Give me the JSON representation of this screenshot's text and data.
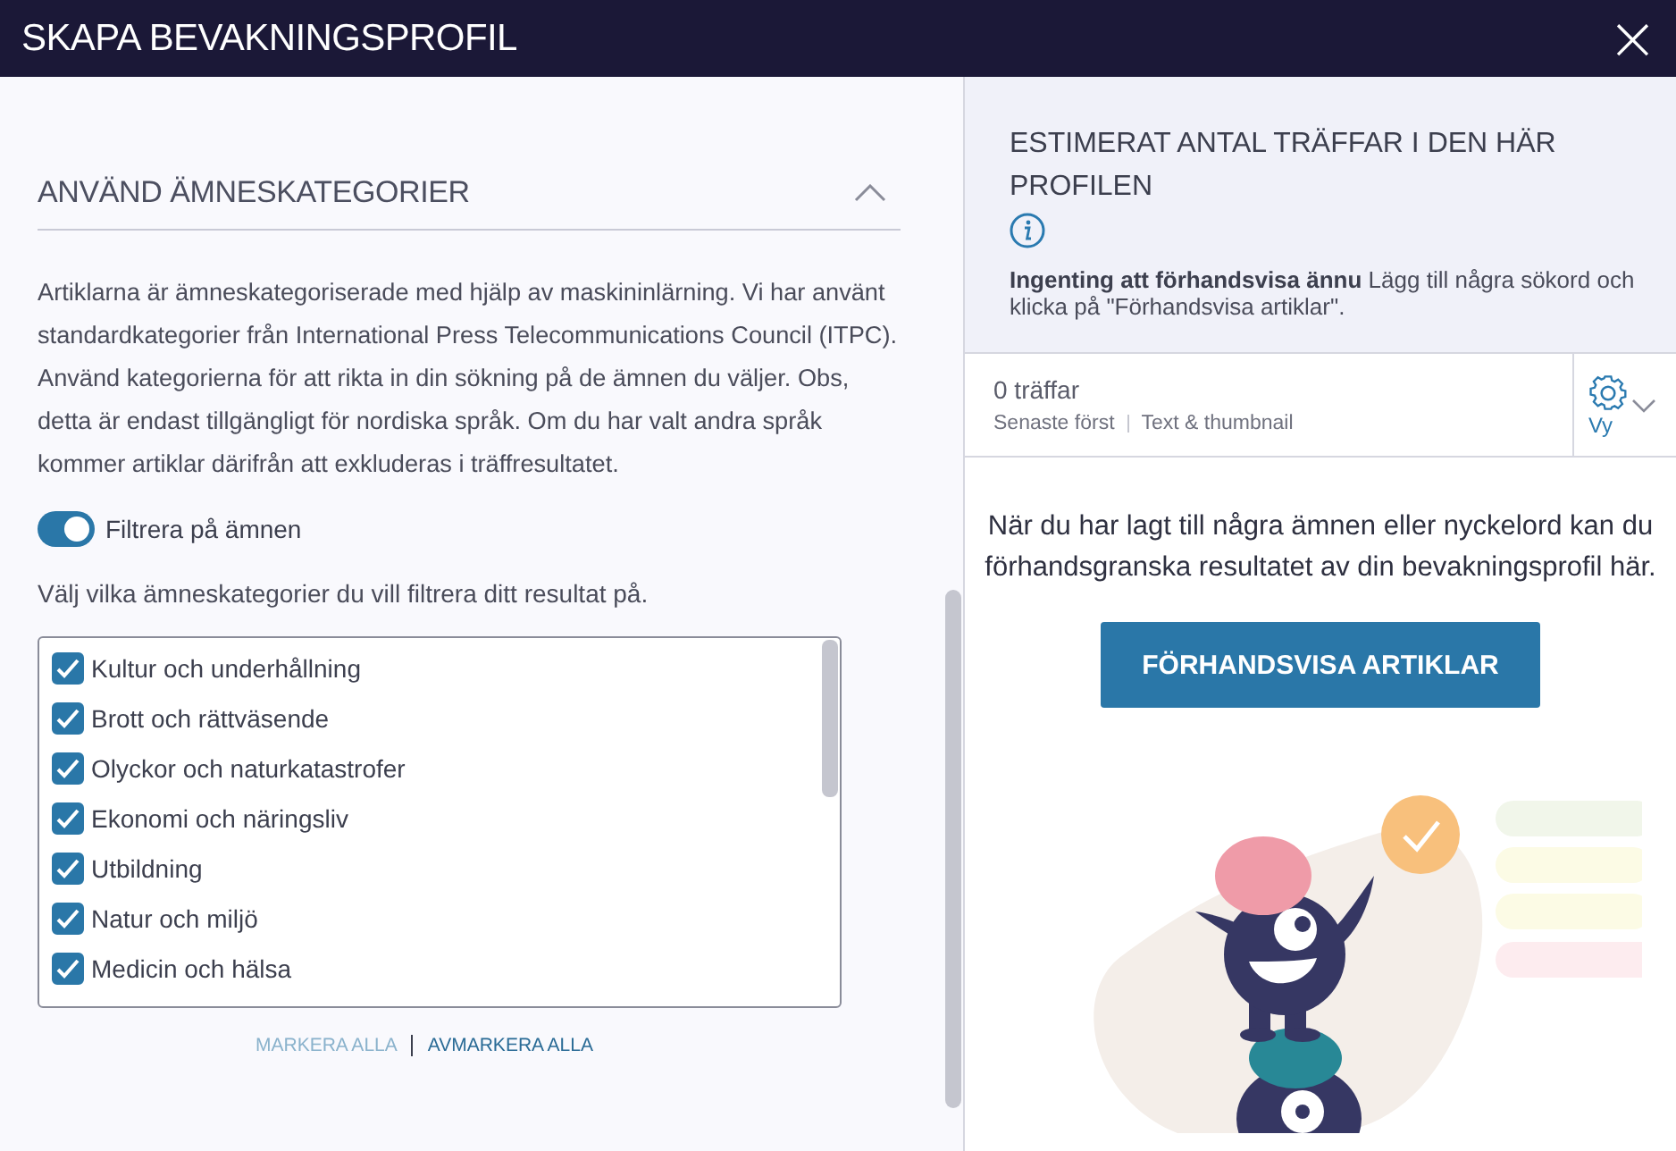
{
  "window": {
    "title": "SKAPA BEVAKNINGSPROFIL",
    "close": "×"
  },
  "section": {
    "title": "ANVÄND ÄMNESKATEGORIER",
    "expanded": true,
    "description": "Artiklarna är ämneskategoriserade med hjälp av maskininlärning. Vi har använt standardkategorier från International Press Telecommunications Council (ITPC). Använd kategorierna för att rikta in din sökning på de ämnen du väljer. Obs, detta är endast tillgängligt för nordiska språk. Om du har valt andra språk kommer artiklar därifrån att exkluderas i träffresultatet.",
    "filter_toggle": {
      "label": "Filtrera på ämnen",
      "on": true
    },
    "prompt": "Välj vilka ämneskategorier du vill filtrera ditt resultat på.",
    "categories": [
      {
        "label": "Kultur och underhållning",
        "checked": true
      },
      {
        "label": "Brott och rättväsende",
        "checked": true
      },
      {
        "label": "Olyckor och naturkatastrofer",
        "checked": true
      },
      {
        "label": "Ekonomi och näringsliv",
        "checked": true
      },
      {
        "label": "Utbildning",
        "checked": true
      },
      {
        "label": "Natur och miljö",
        "checked": true
      },
      {
        "label": "Medicin och hälsa",
        "checked": true
      }
    ],
    "links": [
      {
        "label": "MARKERA ALLA",
        "disabled": true
      },
      {
        "label": "AVMARKERA ALLA",
        "disabled": false
      }
    ]
  },
  "preview": {
    "title": "ESTIMERAT ANTAL TRÄFFAR I DEN HÄR PROFILEN",
    "note": "**Ingenting att förhandsvisa ännu** Lägg till några sökord och klicka på \"Förhandsvisa artiklar\".",
    "hits": "0 träffar",
    "sort": "Senaste först",
    "view_mode": "Text & thumbnail",
    "view_button": "Vy",
    "empty_message": "När du har lagt till några ämnen eller nyckelord kan du förhandsgranska resultatet av din bevakningsprofil här.",
    "preview_button": "FÖRHANDSVISA ARTIKLAR"
  }
}
